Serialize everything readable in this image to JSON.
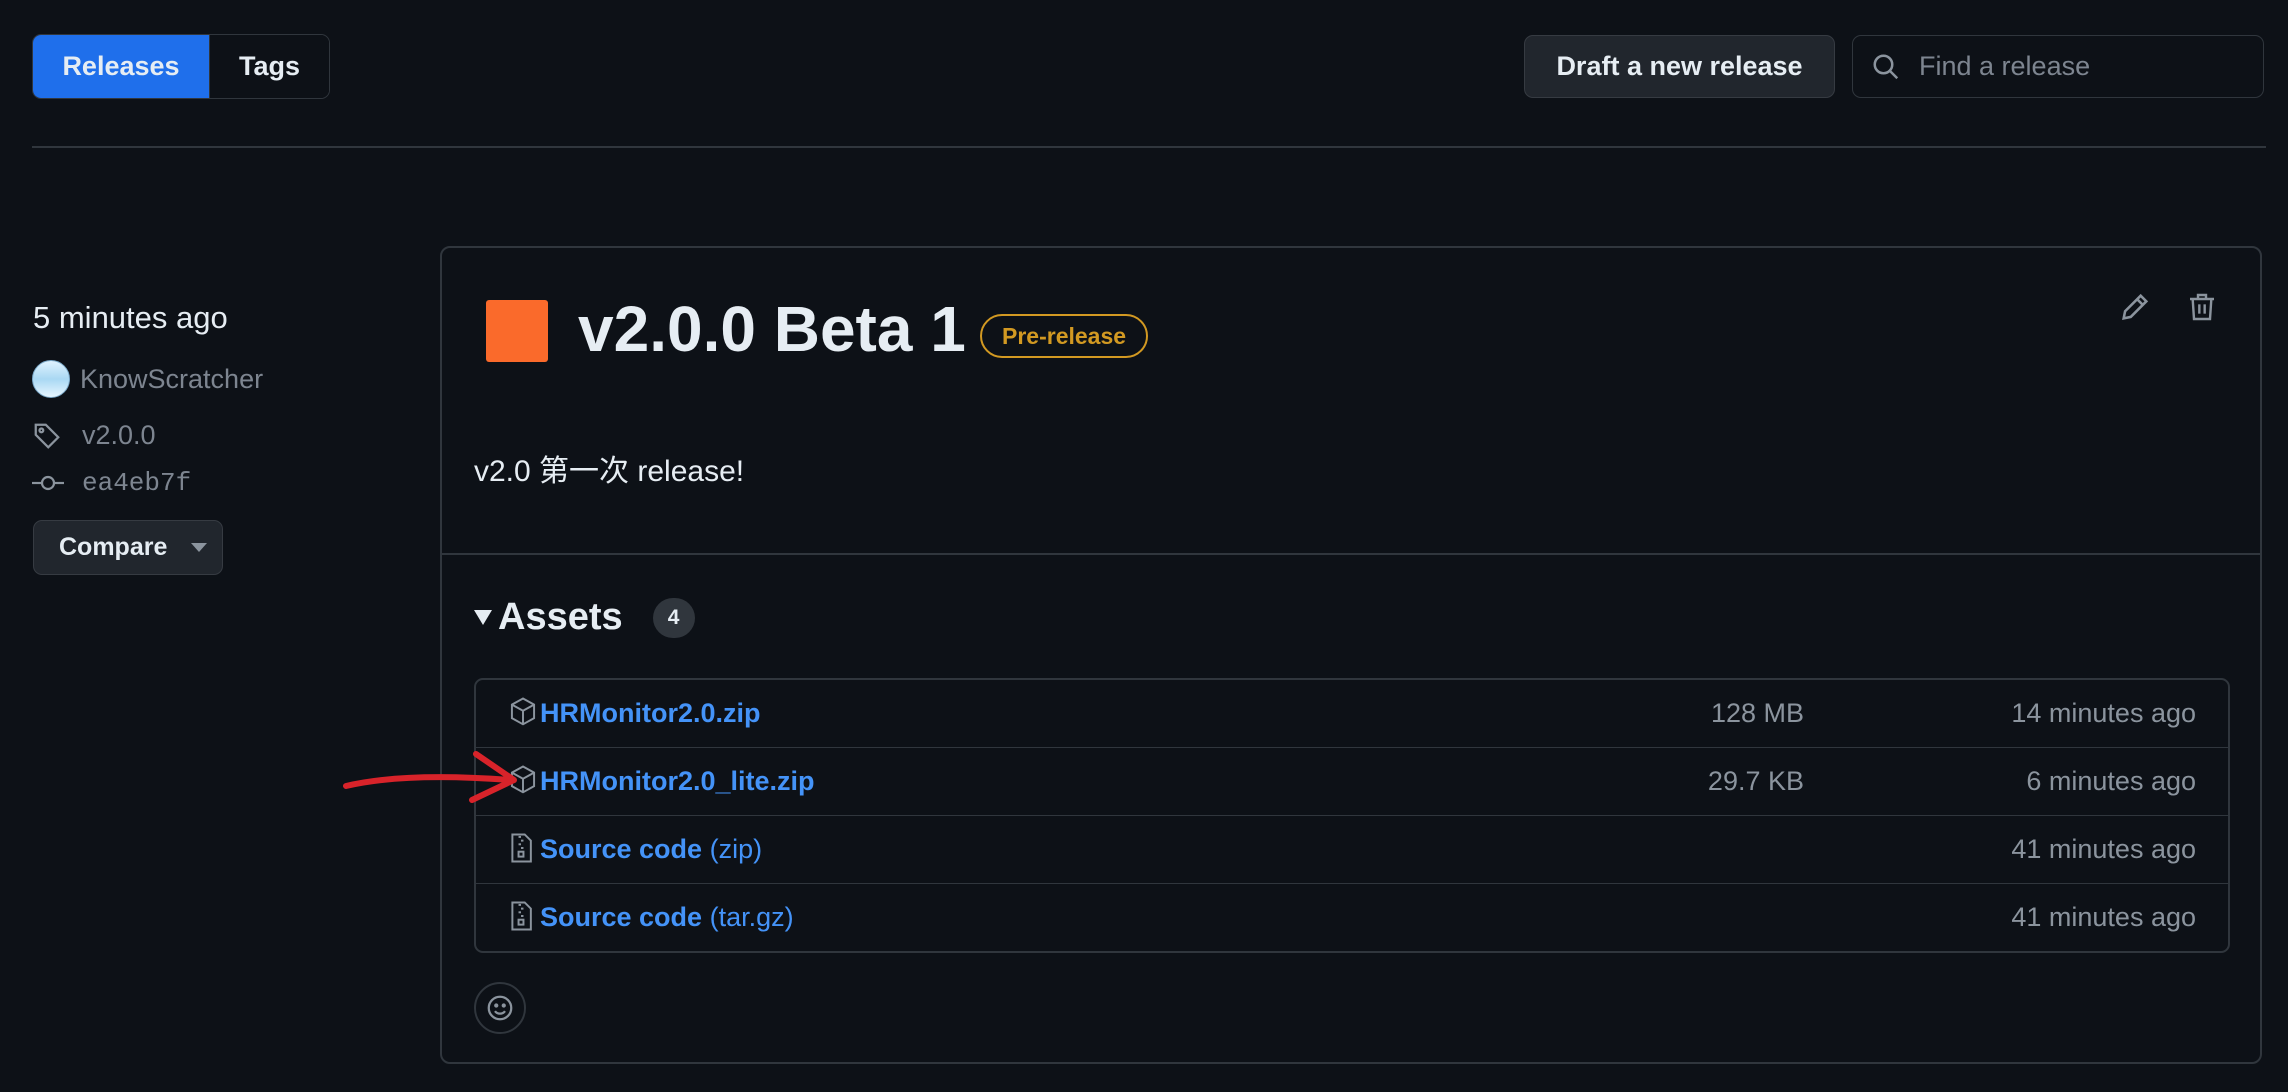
{
  "top": {
    "tabs": [
      {
        "label": "Releases"
      },
      {
        "label": "Tags"
      }
    ],
    "draft_label": "Draft a new release",
    "search_placeholder": "Find a release"
  },
  "meta": {
    "time_ago": "5 minutes ago",
    "author": "KnowScratcher",
    "tag": "v2.0.0",
    "commit": "ea4eb7f",
    "compare_label": "Compare"
  },
  "release": {
    "title": "v2.0.0 Beta 1",
    "badge": "Pre-release",
    "description": "v2.0 第一次 release!",
    "accent": "#fa6a2b"
  },
  "assets": {
    "title": "Assets",
    "count": "4",
    "items": [
      {
        "icon": "package-icon",
        "name": "HRMonitor2.0.zip",
        "sub": "",
        "size": "128 MB",
        "ago": "14 minutes ago"
      },
      {
        "icon": "package-icon",
        "name": "HRMonitor2.0_lite.zip",
        "sub": "",
        "size": "29.7 KB",
        "ago": "6 minutes ago"
      },
      {
        "icon": "file-zip-icon",
        "name": "Source code",
        "sub": "(zip)",
        "size": "",
        "ago": "41 minutes ago"
      },
      {
        "icon": "file-zip-icon",
        "name": "Source code",
        "sub": "(tar.gz)",
        "size": "",
        "ago": "41 minutes ago"
      }
    ]
  }
}
